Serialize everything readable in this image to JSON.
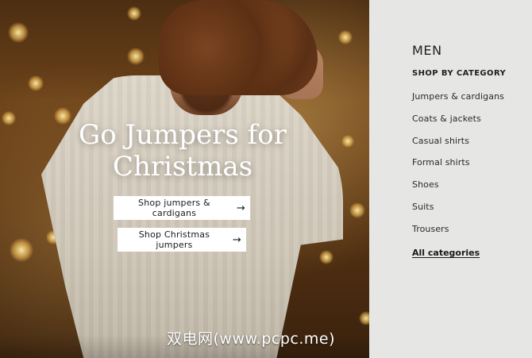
{
  "hero": {
    "headline": "Go Jumpers for Christmas",
    "buttons": [
      {
        "label": "Shop jumpers & cardigans",
        "icon": "arrow-right-icon"
      },
      {
        "label": "Shop Christmas jumpers",
        "icon": "arrow-right-icon"
      }
    ]
  },
  "sidebar": {
    "title": "MEN",
    "section_title": "SHOP BY CATEGORY",
    "categories": [
      "Jumpers & cardigans",
      "Coats & jackets",
      "Casual shirts",
      "Formal shirts",
      "Shoes",
      "Suits",
      "Trousers"
    ],
    "all_link": "All categories"
  },
  "watermark": {
    "text": "双电网(www.pcpc.me)"
  },
  "colors": {
    "sidebar_bg": "#e6e6e4",
    "text_dark": "#1f1f1f",
    "button_bg": "#ffffff"
  }
}
